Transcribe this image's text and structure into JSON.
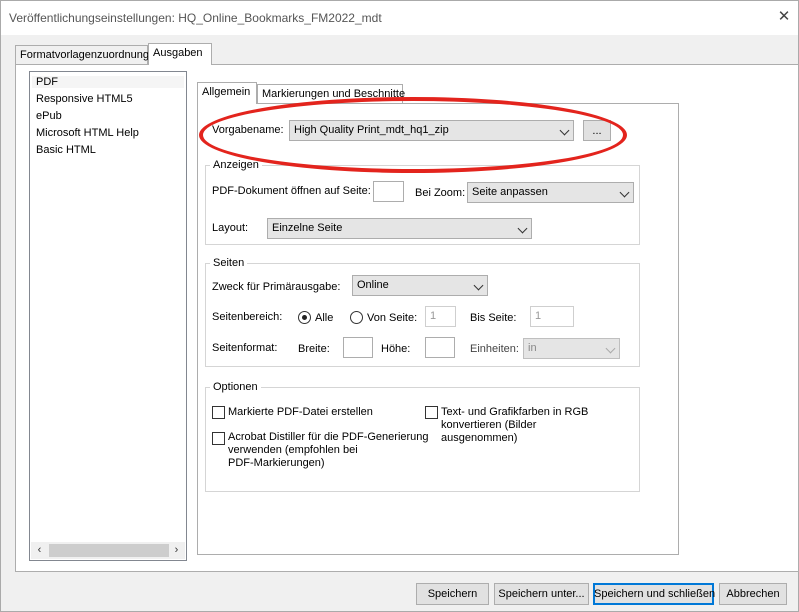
{
  "window": {
    "title": "Veröffentlichungseinstellungen: HQ_Online_Bookmarks_FM2022_mdt"
  },
  "outer_tabs": [
    {
      "label": "Formatvorlagenzuordnung"
    },
    {
      "label": "Ausgaben"
    }
  ],
  "output_list": {
    "items": [
      "PDF",
      "Responsive HTML5",
      "ePub",
      "Microsoft HTML Help",
      "Basic HTML"
    ],
    "selected": "PDF"
  },
  "inner_tabs": [
    {
      "label": "Allgemein"
    },
    {
      "label": "Markierungen und Beschnitte"
    }
  ],
  "preset": {
    "label": "Vorgabename:",
    "value": "High Quality Print_mdt_hq1_zip",
    "browse_label": "..."
  },
  "anzeigen": {
    "title": "Anzeigen",
    "open_label": "PDF-Dokument öffnen auf Seite:",
    "open_value": "",
    "zoom_label": "Bei Zoom:",
    "zoom_value": "Seite anpassen",
    "layout_label": "Layout:",
    "layout_value": "Einzelne Seite"
  },
  "seiten": {
    "title": "Seiten",
    "purpose_label": "Zweck für Primärausgabe:",
    "purpose_value": "Online",
    "range_label": "Seitenbereich:",
    "all_label": "Alle",
    "from_label": "Von Seite:",
    "from_value": "1",
    "to_label": "Bis Seite:",
    "to_value": "1",
    "format_label": "Seitenformat:",
    "width_label": "Breite:",
    "width_value": "",
    "height_label": "Höhe:",
    "height_value": "",
    "units_label": "Einheiten:",
    "units_value": "in"
  },
  "optionen": {
    "title": "Optionen",
    "tagged_pdf": "Markierte PDF-Datei erstellen",
    "distiller_line1": "Acrobat Distiller für die PDF-Generierung",
    "distiller_line2": "verwenden (empfohlen bei",
    "distiller_line3": "PDF-Markierungen)",
    "rgb_line1": "Text- und Grafikfarben in RGB",
    "rgb_line2": "konvertieren (Bilder",
    "rgb_line3": "ausgenommen)"
  },
  "footer": {
    "save": "Speichern",
    "save_as": "Speichern unter...",
    "save_close": "Speichern und schließen",
    "cancel": "Abbrechen"
  },
  "colors": {
    "highlight": "#e3241d",
    "default_button_border": "#0078d7"
  }
}
